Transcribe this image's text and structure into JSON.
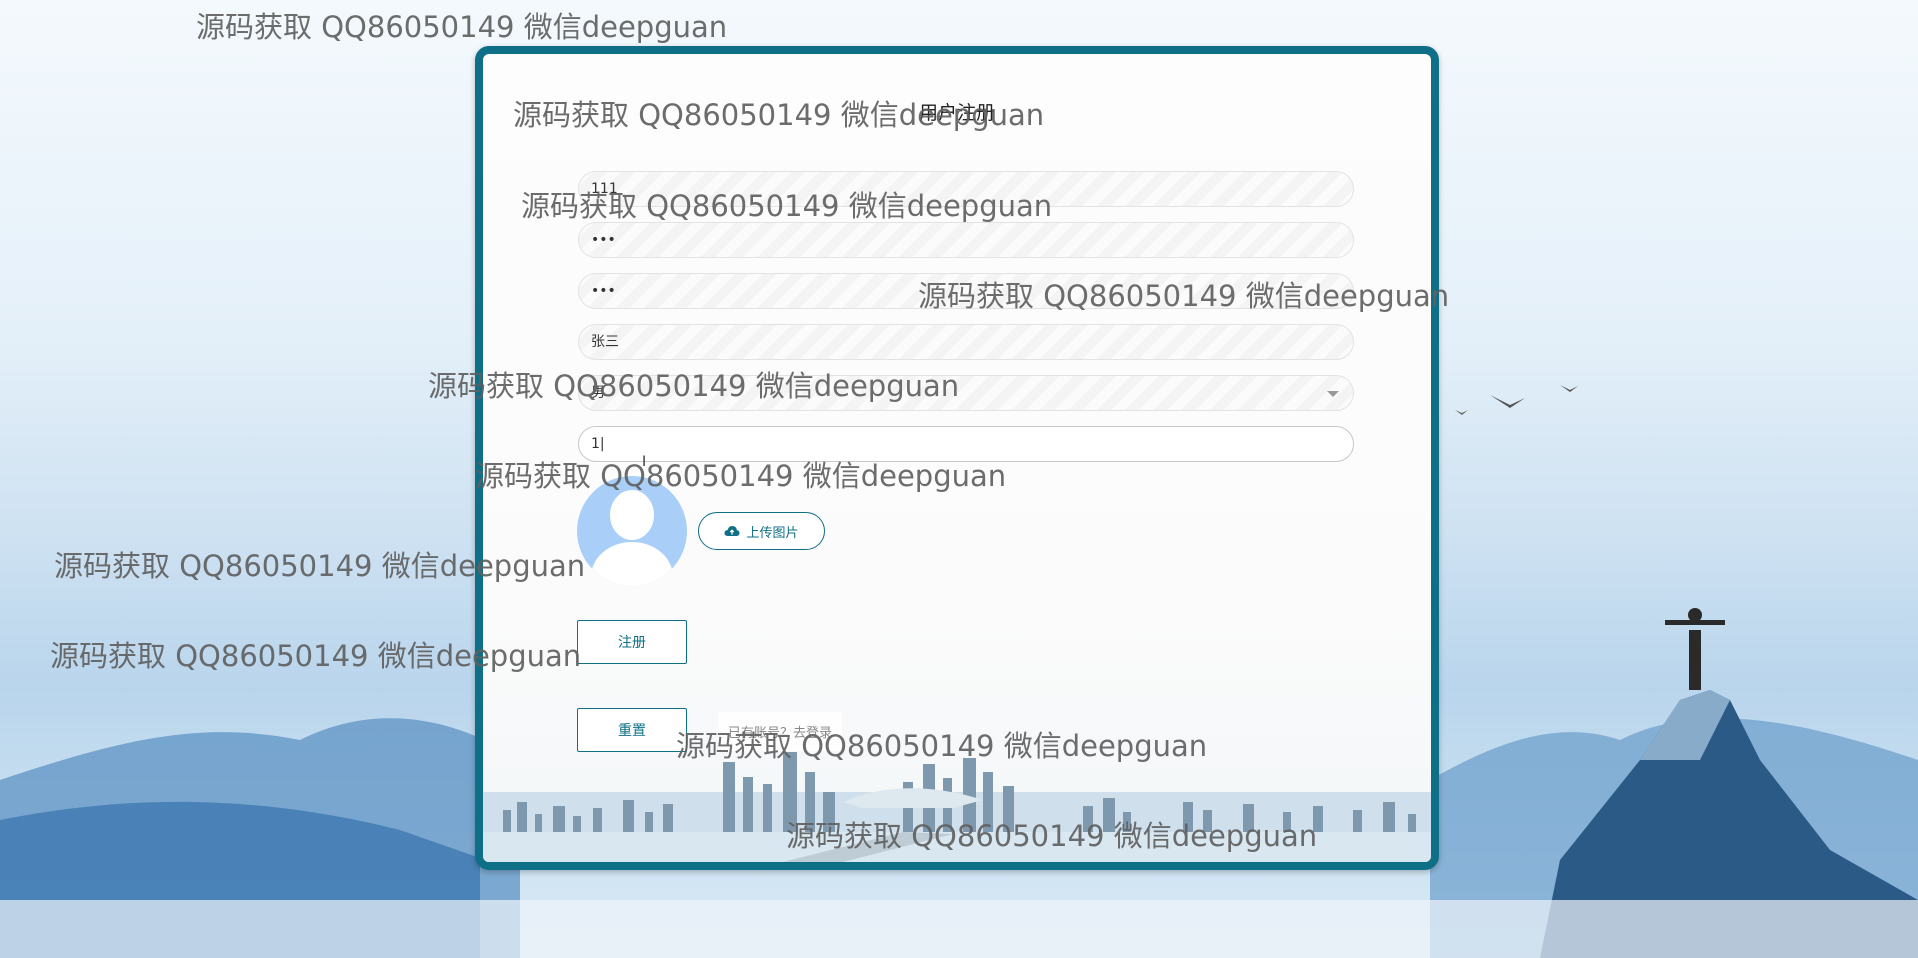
{
  "form": {
    "title": "用户注册",
    "username_value": "111",
    "password_value": "•••",
    "confirm_password_value": "•••",
    "name_value": "张三",
    "gender_value": "男",
    "age_value": "1",
    "upload_label": "上传图片",
    "register_label": "注册",
    "reset_label": "重置",
    "login_link": "已有账号？去登录"
  },
  "watermarks": [
    "源码获取 QQ86050149 微信deepguan",
    "源码获取 QQ86050149 微信deepguan",
    "源码获取 QQ86050149 微信deepguan",
    "源码获取 QQ86050149 微信deepguan",
    "源码获取 QQ86050149 微信deepguan",
    "源码获取 QQ86050149 微信deepguan",
    "源码获取 QQ86050149 微信deepguan",
    "源码获取 QQ86050149 微信deepguan",
    "源码获取 QQ86050149 微信deepguan",
    "源码获取 QQ86050149 微信deepguan"
  ],
  "icons": {
    "upload": "cloud-upload-icon",
    "avatar": "user-avatar-icon",
    "select": "chevron-down-icon"
  },
  "colors": {
    "accent": "#0e6f86",
    "avatar": "#a9cff8"
  }
}
